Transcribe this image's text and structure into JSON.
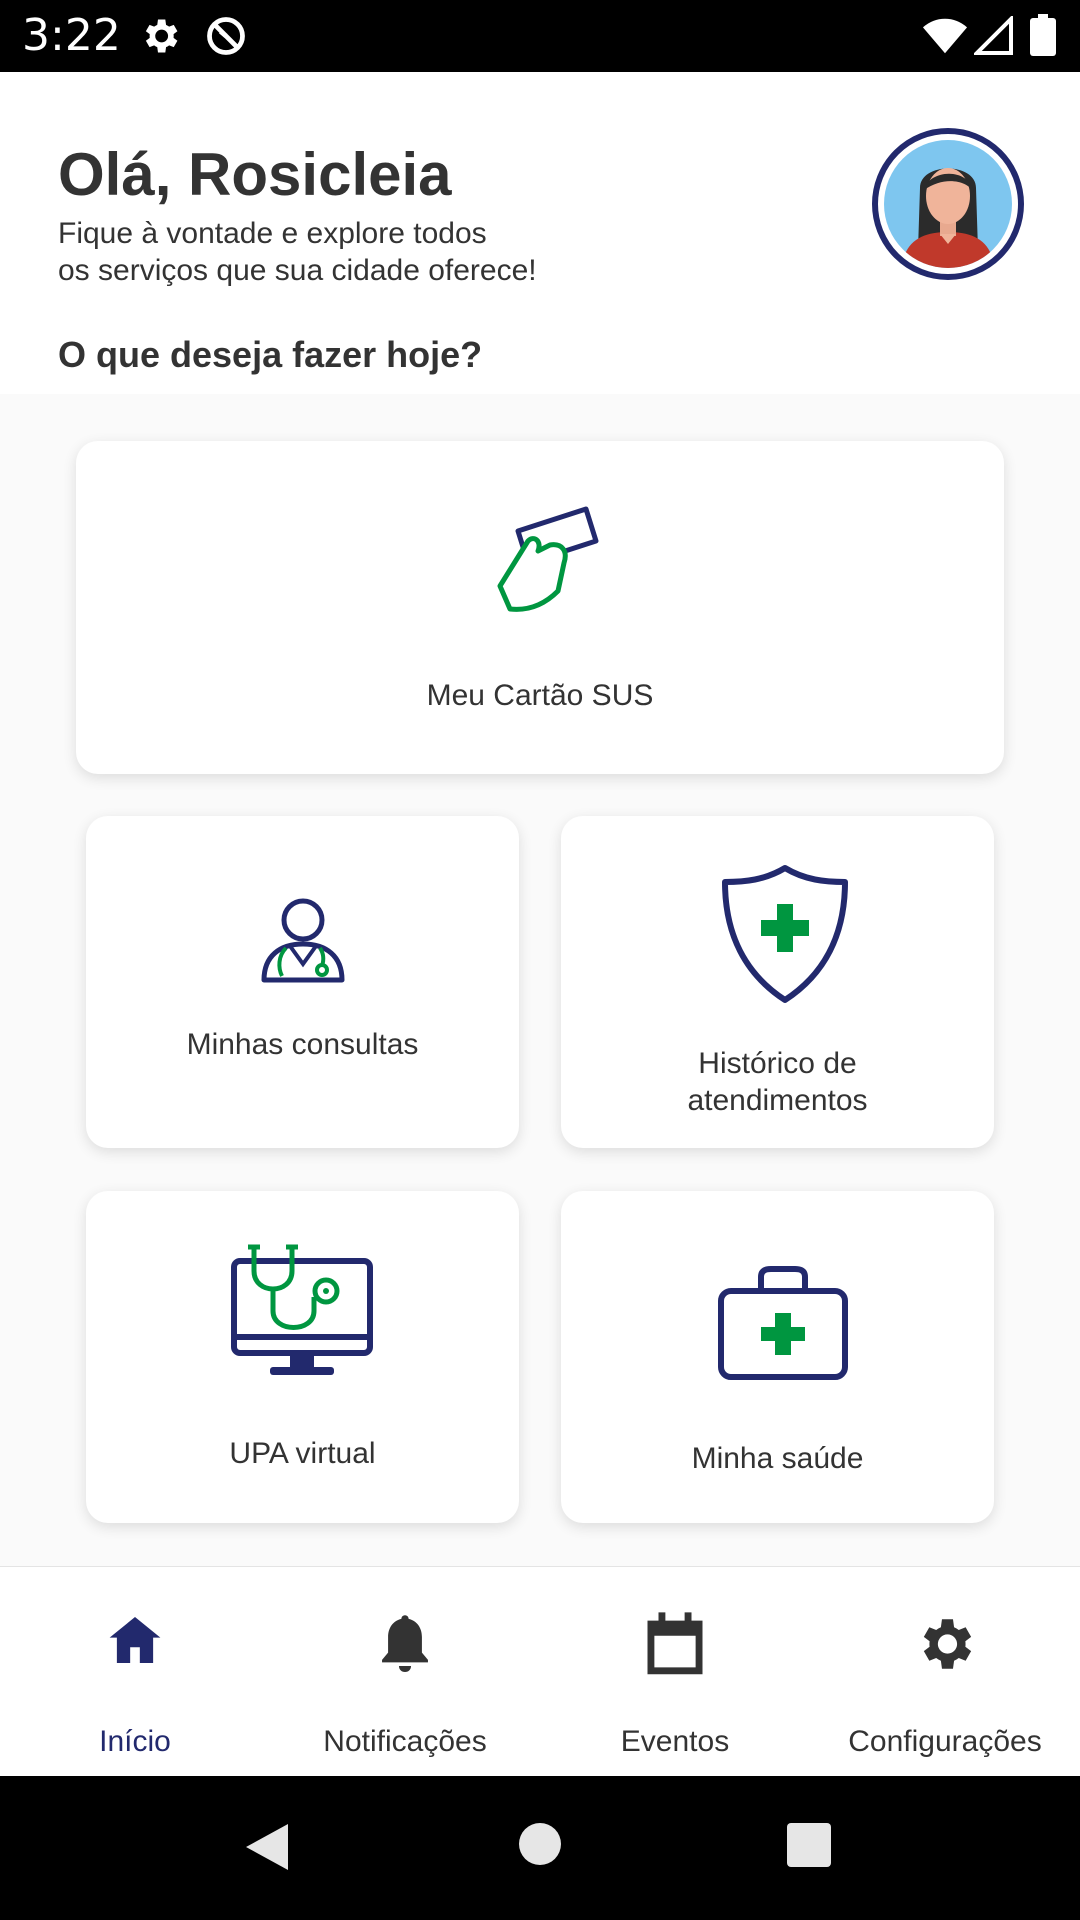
{
  "status_bar": {
    "time": "3:22",
    "left_icons": [
      "settings-icon",
      "do-not-disturb-icon"
    ],
    "right_icons": [
      "wifi-icon",
      "signal-icon",
      "battery-icon"
    ]
  },
  "header": {
    "greeting": "Olá, Rosicleia",
    "subtitle_line1": "Fique à vontade e explore todos",
    "subtitle_line2": "os serviços que sua cidade oferece!",
    "question": "O que deseja fazer hoje?"
  },
  "cards": {
    "sus_card": {
      "label": "Meu Cartão SUS",
      "icon": "hand-card-icon"
    },
    "consultas": {
      "label": "Minhas consultas",
      "icon": "doctor-icon"
    },
    "historico": {
      "label_line1": "Histórico de",
      "label_line2": "atendimentos",
      "icon": "shield-cross-icon"
    },
    "upa": {
      "label": "UPA virtual",
      "icon": "monitor-stethoscope-icon"
    },
    "saude": {
      "label": "Minha saúde",
      "icon": "medical-kit-icon"
    }
  },
  "bottom_nav": {
    "items": [
      {
        "label": "Início",
        "icon": "home-icon",
        "active": true
      },
      {
        "label": "Notificações",
        "icon": "bell-icon",
        "active": false
      },
      {
        "label": "Eventos",
        "icon": "calendar-icon",
        "active": false
      },
      {
        "label": "Configurações",
        "icon": "gear-icon",
        "active": false
      }
    ]
  },
  "colors": {
    "primary_navy": "#22296d",
    "accent_green": "#009640",
    "text": "#333333"
  }
}
